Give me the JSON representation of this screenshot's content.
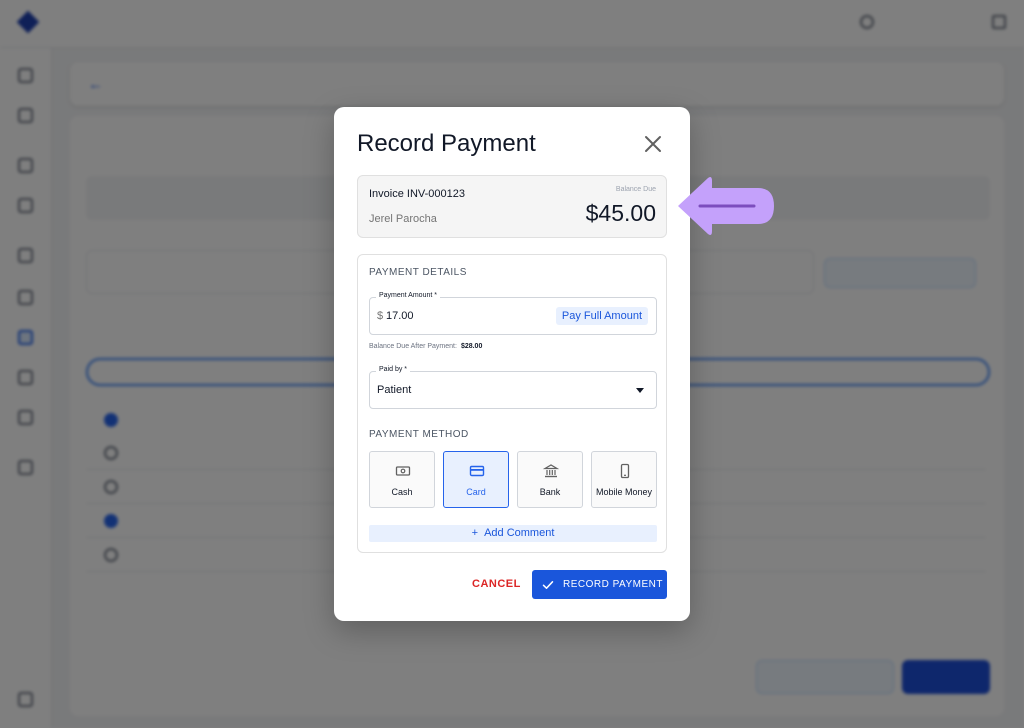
{
  "modal": {
    "title": "Record Payment",
    "invoice": {
      "number": "Invoice INV-000123",
      "patient": "Jerel Parocha",
      "balance_label": "Balance Due",
      "balance_amount": "$45.00"
    },
    "details": {
      "section_title": "PAYMENT DETAILS",
      "amount_label": "Payment Amount *",
      "currency": "$",
      "amount_value": "17.00",
      "pay_full_label": "Pay Full Amount",
      "balance_after_label": "Balance Due After Payment:",
      "balance_after_value": "$28.00",
      "paid_by_label": "Paid by *",
      "paid_by_value": "Patient"
    },
    "method": {
      "section_title": "PAYMENT METHOD",
      "options": [
        {
          "label": "Cash",
          "icon": "cash-icon"
        },
        {
          "label": "Card",
          "icon": "card-icon"
        },
        {
          "label": "Bank",
          "icon": "bank-icon"
        },
        {
          "label": "Mobile Money",
          "icon": "mobile-icon"
        }
      ],
      "selected": "Card"
    },
    "add_comment_label": "Add Comment",
    "cancel_label": "CANCEL",
    "record_label": "RECORD PAYMENT"
  },
  "colors": {
    "primary": "#1a56db",
    "danger": "#dc2626",
    "callout": "#c084fc"
  }
}
